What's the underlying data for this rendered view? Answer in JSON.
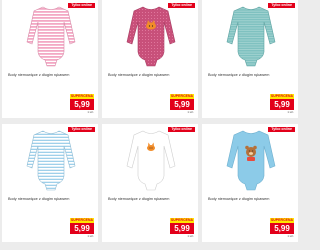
{
  "products": [
    {
      "tag": "Tylko online",
      "description": "Body niemowlęce z długim rękawem",
      "badge": "SUPERCENA",
      "price": "5,99",
      "unit": "1 szt.",
      "color": "#f3a8c4",
      "stripe": "#ffffff",
      "print": "none"
    },
    {
      "tag": "Tylko online",
      "description": "Body niemowlęce z długim rękawem",
      "badge": "SUPERCENA",
      "price": "5,99",
      "unit": "1 szt.",
      "color": "#c8507a",
      "stripe": "#e883a8",
      "print": "fox"
    },
    {
      "tag": "Tylko online",
      "description": "Body niemowlęce z długim rękawem",
      "badge": "SUPERCENA",
      "price": "5,99",
      "unit": "1 szt.",
      "color": "#7fc1c0",
      "stripe": "#a8d6d4",
      "print": "none"
    },
    {
      "tag": "Tylko online",
      "description": "Body niemowlęce z długim rękawem",
      "badge": "SUPERCENA",
      "price": "5,99",
      "unit": "1 szt.",
      "color": "#ffffff",
      "stripe": "#9fd0ea",
      "print": "none"
    },
    {
      "tag": "Tylko online",
      "description": "Body niemowlęce z długim rękawem",
      "badge": "SUPERCENA",
      "price": "5,99",
      "unit": "1 szt.",
      "color": "#ffffff",
      "stripe": "#ffffff",
      "print": "fox"
    },
    {
      "tag": "Tylko online",
      "description": "Body niemowlęce z długim rękawem",
      "badge": "SUPERCENA",
      "price": "5,99",
      "unit": "1 szt.",
      "color": "#8ccbe8",
      "stripe": "#8ccbe8",
      "print": "bear"
    }
  ]
}
